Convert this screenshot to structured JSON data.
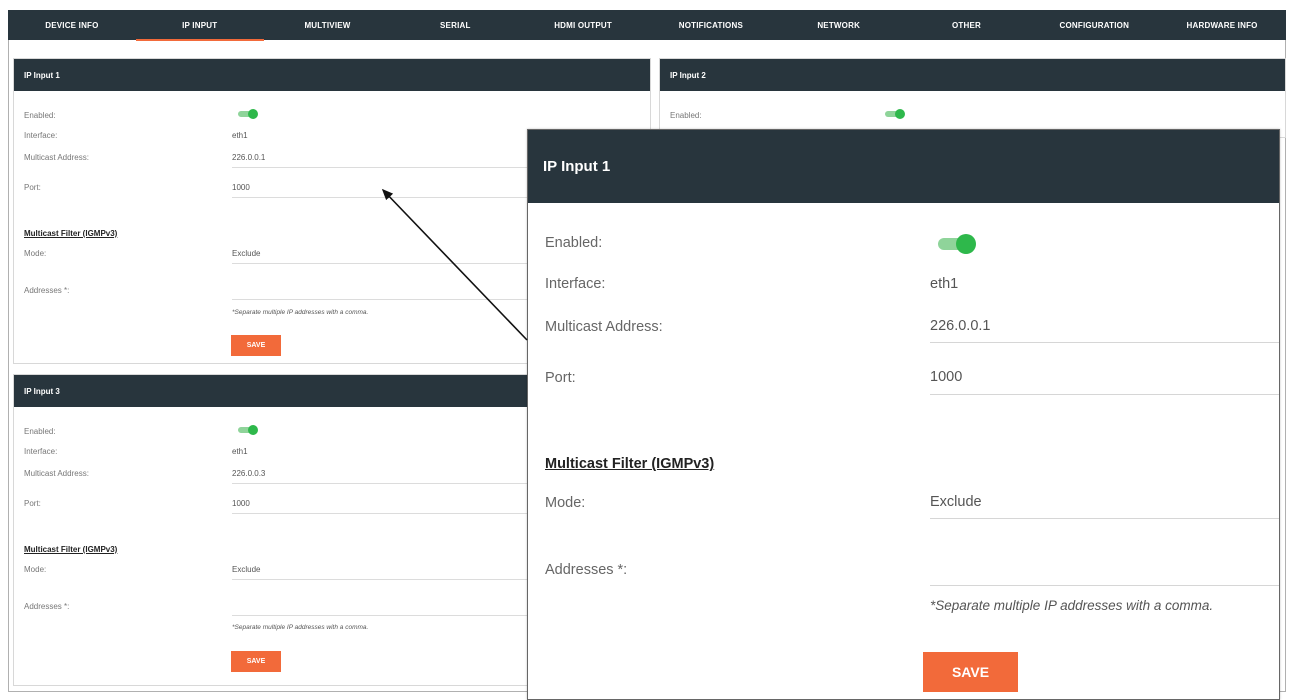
{
  "nav": {
    "tabs": [
      {
        "label": "DEVICE INFO"
      },
      {
        "label": "IP INPUT"
      },
      {
        "label": "MULTIVIEW"
      },
      {
        "label": "SERIAL"
      },
      {
        "label": "HDMI OUTPUT"
      },
      {
        "label": "NOTIFICATIONS"
      },
      {
        "label": "NETWORK"
      },
      {
        "label": "OTHER"
      },
      {
        "label": "CONFIGURATION"
      },
      {
        "label": "HARDWARE INFO"
      }
    ],
    "active_index": 1
  },
  "labels": {
    "enabled": "Enabled:",
    "interface": "Interface:",
    "multicast_address": "Multicast Address:",
    "port": "Port:",
    "filter_section": "Multicast Filter (IGMPv3)",
    "mode": "Mode:",
    "addresses": "Addresses *:",
    "hint": "*Separate multiple IP addresses with a comma.",
    "save": "SAVE"
  },
  "panels": {
    "ip_input_1": {
      "title": "IP Input 1",
      "enabled": true,
      "interface": "eth1",
      "multicast_address": "226.0.0.1",
      "port": "1000",
      "mode": "Exclude",
      "addresses": ""
    },
    "ip_input_2": {
      "title": "IP Input 2",
      "enabled": true
    },
    "ip_input_3": {
      "title": "IP Input 3",
      "enabled": true,
      "interface": "eth1",
      "multicast_address": "226.0.0.3",
      "port": "1000",
      "mode": "Exclude",
      "addresses": ""
    }
  },
  "zoom": {
    "title": "IP Input 1",
    "enabled": true,
    "interface": "eth1",
    "multicast_address": "226.0.0.1",
    "port": "1000",
    "mode": "Exclude",
    "addresses": ""
  },
  "colors": {
    "header_bg": "#28353d",
    "accent": "#f26a3a",
    "toggle_on": "#2eb84b"
  }
}
